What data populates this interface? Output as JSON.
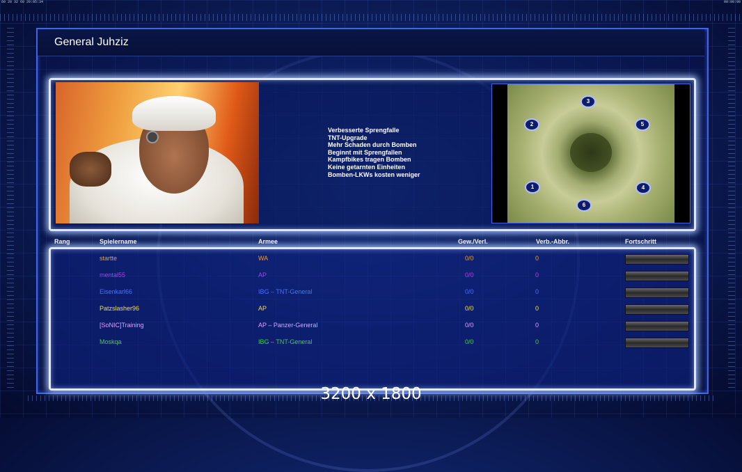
{
  "topbar": {
    "left": "60 20 32 60 20:05:34",
    "right": "00:00:00"
  },
  "general": {
    "title": "General Juhziz"
  },
  "bonuses": [
    "Verbesserte Sprengfalle",
    "TNT-Upgrade",
    "Mehr Schaden durch Bomben",
    "Beginnt mit Sprengfallen",
    "Kampfbikes tragen Bomben",
    "Keine getarnten Einheiten",
    "Bomben-LKWs kosten weniger"
  ],
  "minimap": {
    "slots": [
      "1",
      "2",
      "3",
      "4",
      "5",
      "6"
    ]
  },
  "table": {
    "headers": {
      "rank": "Rang",
      "player": "Spielername",
      "army": "Armee",
      "wins": "Gew./Verl.",
      "disc": "Verb.-Abbr.",
      "progress": "Fortschritt"
    },
    "rows": [
      {
        "player": "startte",
        "army": "WA",
        "wins": "0/0",
        "disc": "0",
        "color": "#f0a020",
        "progress": 0
      },
      {
        "player": "mental55",
        "army": "AP",
        "wins": "0/0",
        "disc": "0",
        "color": "#b040e0",
        "progress": 0
      },
      {
        "player": "Eisenkarl66",
        "army": "IBG – TNT-General",
        "wins": "0/0",
        "disc": "0",
        "color": "#4a70ff",
        "progress": 0
      },
      {
        "player": "Patzslasher96",
        "army": "AP",
        "wins": "0/0",
        "disc": "0",
        "color": "#f0e040",
        "progress": 0
      },
      {
        "player": "[SoNIC]Training",
        "army": "AP – Panzer-General",
        "wins": "0/0",
        "disc": "0",
        "color": "#e0a0ff",
        "progress": 0
      },
      {
        "player": "Moskqa",
        "army": "IBG – TNT-General",
        "wins": "0/0",
        "disc": "0",
        "color": "#40d040",
        "progress": 0
      }
    ]
  },
  "overlay": {
    "resolution": "3200 x 1800"
  }
}
